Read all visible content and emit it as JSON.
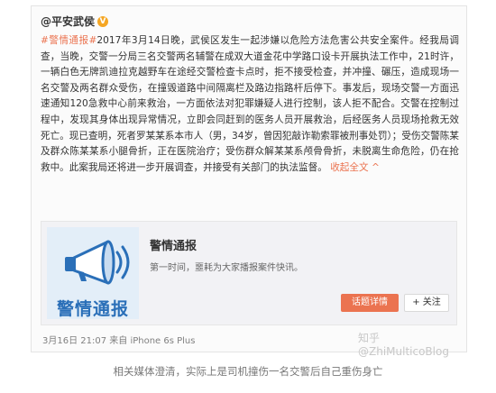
{
  "post": {
    "author": "@平安武侯",
    "verified_mark": "V",
    "hashtag": "#警情通报#",
    "body": "2017年3月14日晚，武侯区发生一起涉嫌以危险方法危害公共安全案件。经我局调查，当晚，交警一分局三名交警两名辅警在成双大道金花中学路口设卡开展执法工作中，21时许，一辆白色无牌凯迪拉克越野车在途经交警检查卡点时，拒不接受检查，并冲撞、碾压，造成现场一名交警及两名群众受伤，在撞毁道路中间隔离栏及路边指路杆后停下。事发后，现场交警一方面迅速通知120急救中心前来救治，一方面依法对犯罪嫌疑人进行控制，该人拒不配合。交警在控制过程中，发现其身体出现异常情况，立即会同赶到的医务人员开展救治，后经医务人员现场抢救无效死亡。现已查明，死者罗某某系本市人（男，34岁，曾因犯敲诈勒索罪被刑事处罚）；受伤交警陈某及群众陈某某系小腿骨折，正在医院治疗；受伤群众解某某系颅骨骨折，未脱离生命危险，仍在抢救中。此案我局还将进一步开展调查，并接受有关部门的执法监督。",
    "expand_label": "收起全文",
    "expand_arrow": "^"
  },
  "card": {
    "title": "警情通报",
    "description": "第一时间，噩耗为大家播报案件快讯。",
    "thumb_text": "警情通报",
    "detail_button": "话题详情",
    "follow_button": "+ 关注"
  },
  "meta": {
    "time": "3月16日 21:07 来自 iPhone 6s Plus"
  },
  "watermark": "知乎 @ZhiMulticoBlog",
  "caption": "相关媒体澄清，实际上是司机撞伤一名交警后自己重伤身亡",
  "colors": {
    "accent": "#eb7350",
    "megaphone_blue": "#2a6fb8",
    "verified": "#f5a623"
  }
}
